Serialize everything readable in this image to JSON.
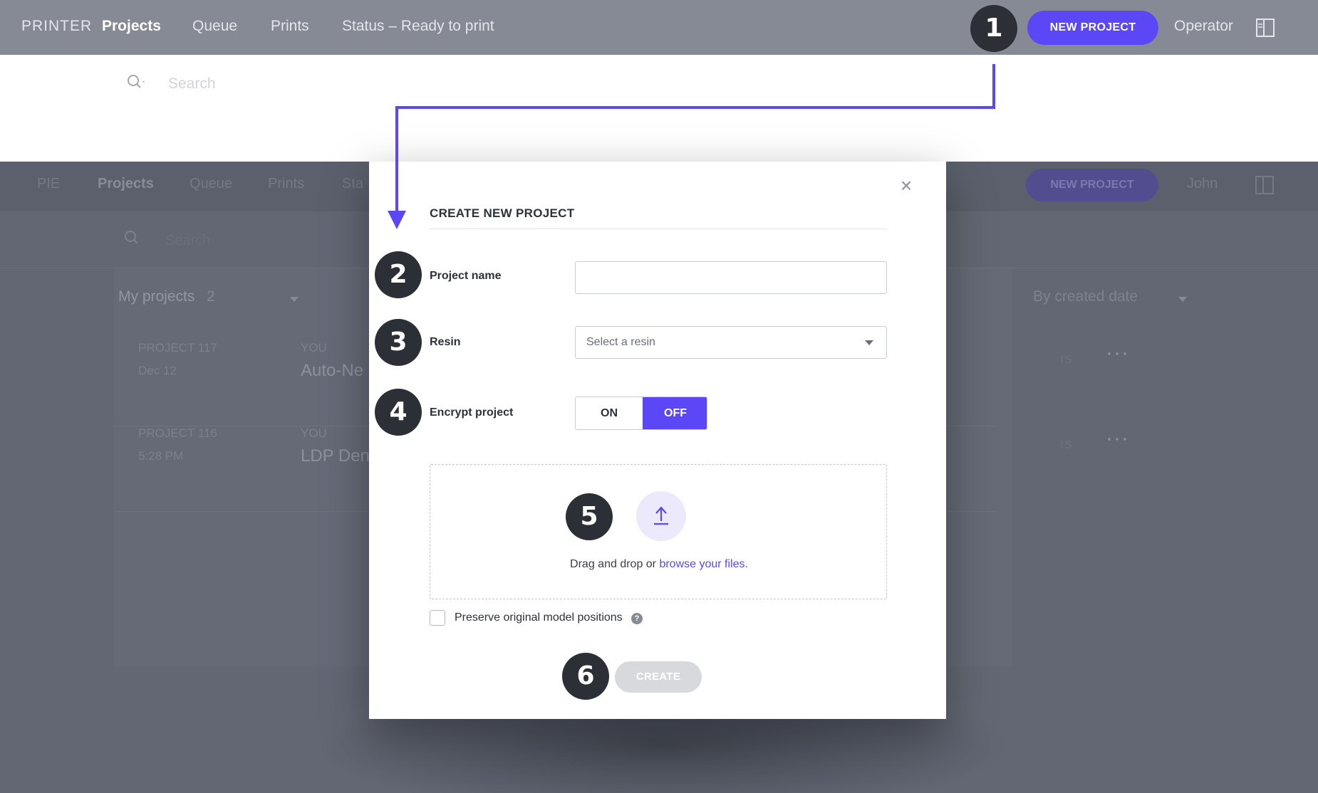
{
  "topbar": {
    "brand": "PRINTER",
    "nav": [
      "Projects",
      "Queue",
      "Prints"
    ],
    "status": "Status – Ready to print",
    "new_project": "NEW PROJECT",
    "user": "Operator",
    "panel_icon": "panel-layout-icon"
  },
  "search": {
    "placeholder": "Search",
    "icon": "search-icon"
  },
  "background": {
    "brand": "PIE",
    "nav": [
      "Projects",
      "Queue",
      "Prints",
      "Sta"
    ],
    "new_project": "NEW PROJECT",
    "user": "John",
    "search_placeholder": "Search",
    "my_projects": "My projects",
    "count": "2",
    "sort": "By created date",
    "rows": [
      {
        "id": "PROJECT 117",
        "date": "Dec 12",
        "owner": "YOU",
        "name": "Auto-Ne",
        "tail": "rs",
        "more": "···"
      },
      {
        "id": "PROJECT 116",
        "date": "5:28 PM",
        "owner": "YOU",
        "name": "LDP Den",
        "tail": "rs",
        "more": "···"
      }
    ]
  },
  "modal": {
    "title": "CREATE NEW PROJECT",
    "close": "×",
    "project_name_label": "Project name",
    "project_name_value": "",
    "resin_label": "Resin",
    "resin_placeholder": "Select a resin",
    "encrypt_label": "Encrypt project",
    "toggle_on": "ON",
    "toggle_off": "OFF",
    "toggle_selected": "OFF",
    "upload_icon": "upload-icon",
    "drop_text": "Drag and drop or ",
    "drop_link": "browse your files.",
    "preserve_label": "Preserve original model positions",
    "preserve_checked": false,
    "help": "?",
    "create": "CREATE"
  },
  "steps": [
    "1",
    "2",
    "3",
    "4",
    "5",
    "6"
  ],
  "colors": {
    "accent": "#5b47f5",
    "badge": "#2c2f36",
    "topbar": "#868a94",
    "overlay": "#626773"
  }
}
